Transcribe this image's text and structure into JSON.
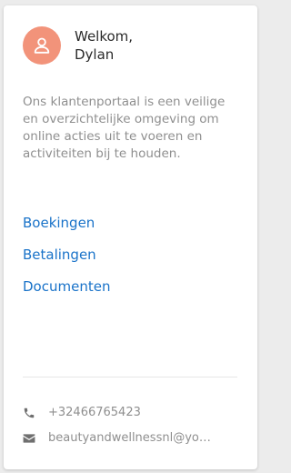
{
  "colors": {
    "accent": "#f2937a",
    "link": "#1a73c9",
    "muted": "#8f8f8f",
    "icon": "#6f6f6f"
  },
  "header": {
    "avatar_icon": "user-icon",
    "greeting_line1": "Welkom,",
    "greeting_line2": "Dylan"
  },
  "intro": {
    "text": "Ons klantenportaal is een veilige en overzichtelijke omgeving om online acties uit te voeren en activiteiten bij te houden."
  },
  "nav": {
    "items": [
      {
        "label": "Boekingen"
      },
      {
        "label": "Betalingen"
      },
      {
        "label": "Documenten"
      }
    ]
  },
  "contact": {
    "phone_icon": "phone-icon",
    "phone": "+32466765423",
    "email_icon": "envelope-icon",
    "email": "beautyandwellnessnl@yo…"
  }
}
